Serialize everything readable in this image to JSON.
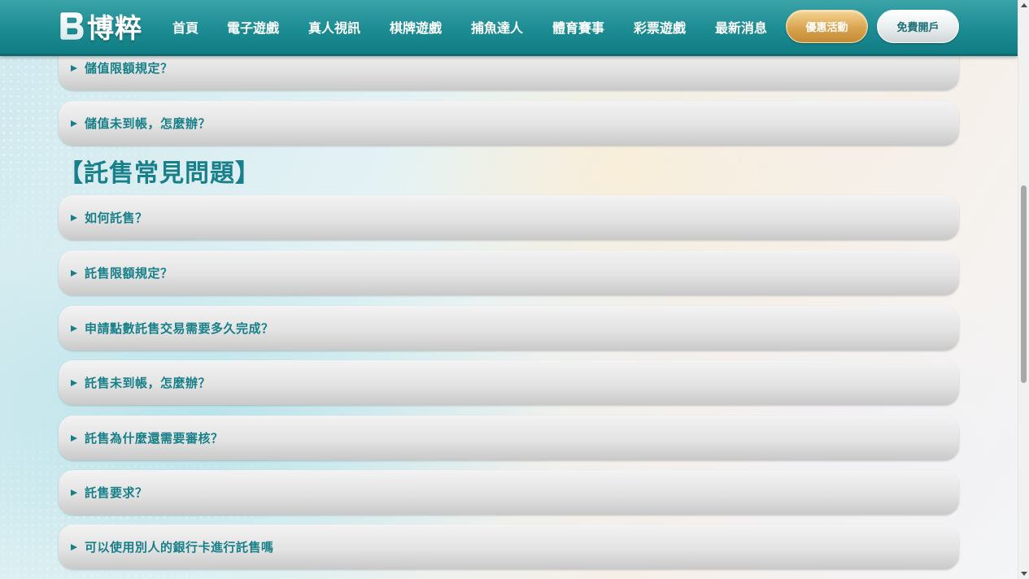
{
  "header": {
    "logo_text": "博粹",
    "nav": [
      {
        "label": "首頁"
      },
      {
        "label": "電子遊戲"
      },
      {
        "label": "真人視訊"
      },
      {
        "label": "棋牌遊戲"
      },
      {
        "label": "捕魚達人"
      },
      {
        "label": "體育賽事"
      },
      {
        "label": "彩票遊戲"
      },
      {
        "label": "最新消息"
      }
    ],
    "promo_button": "優惠活動",
    "register_button": "免費開戶"
  },
  "deposit_faq": [
    {
      "question": "儲值限額規定？"
    },
    {
      "question": "儲值未到帳，怎麼辦？"
    }
  ],
  "consign_section": {
    "title": "【託售常見問題】",
    "items": [
      {
        "question": "如何託售？"
      },
      {
        "question": "託售限額規定？"
      },
      {
        "question": "申請點數託售交易需要多久完成？"
      },
      {
        "question": "託售未到帳，怎麼辦？"
      },
      {
        "question": "託售為什麼還需要審核？"
      },
      {
        "question": "託售要求？"
      },
      {
        "question": "可以使用別人的銀行卡進行託售嗎"
      }
    ]
  },
  "icons": {
    "logo": "logo-b-icon",
    "expand": "triangle-right-icon"
  },
  "colors": {
    "header_teal": "#1c8c93",
    "text_teal": "#177f88",
    "promo_gold": "#d9a450"
  }
}
